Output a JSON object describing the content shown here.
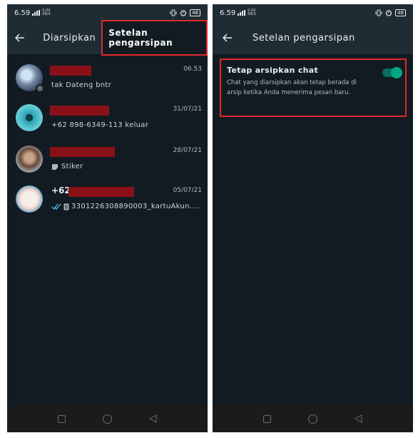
{
  "left_screen": {
    "status": {
      "time": "6.59",
      "net_top": "0.04",
      "net_bottom": "KB/S",
      "battery": "48"
    },
    "header": {
      "tab_label": "Diarsipkan",
      "settings_label": "Setelan pengarsipan"
    },
    "chats": [
      {
        "name": "",
        "time": "06.53",
        "preview": "tak Dateng bntr"
      },
      {
        "name": "",
        "time": "31/07/21",
        "preview": "+62 898-6349-113 keluar"
      },
      {
        "name": "",
        "time": "28/07/21",
        "preview": "Stiker"
      },
      {
        "name": "+62",
        "time": "05/07/21",
        "preview": "3301226308890003_kartuAkun...."
      }
    ]
  },
  "right_screen": {
    "status": {
      "time": "6.59",
      "net_top": "0.00",
      "net_bottom": "KB/S",
      "battery": "48"
    },
    "header": {
      "title": "Setelan pengarsipan"
    },
    "setting": {
      "title": "Tetap arsipkan chat",
      "description": "Chat yang diarsipkan akan tetap berada di arsip ketika Anda menerima pesan baru.",
      "toggle_on": true
    }
  },
  "colors": {
    "accent": "#00a884",
    "highlight_border": "#e0282d",
    "redaction": "#8a1118"
  }
}
